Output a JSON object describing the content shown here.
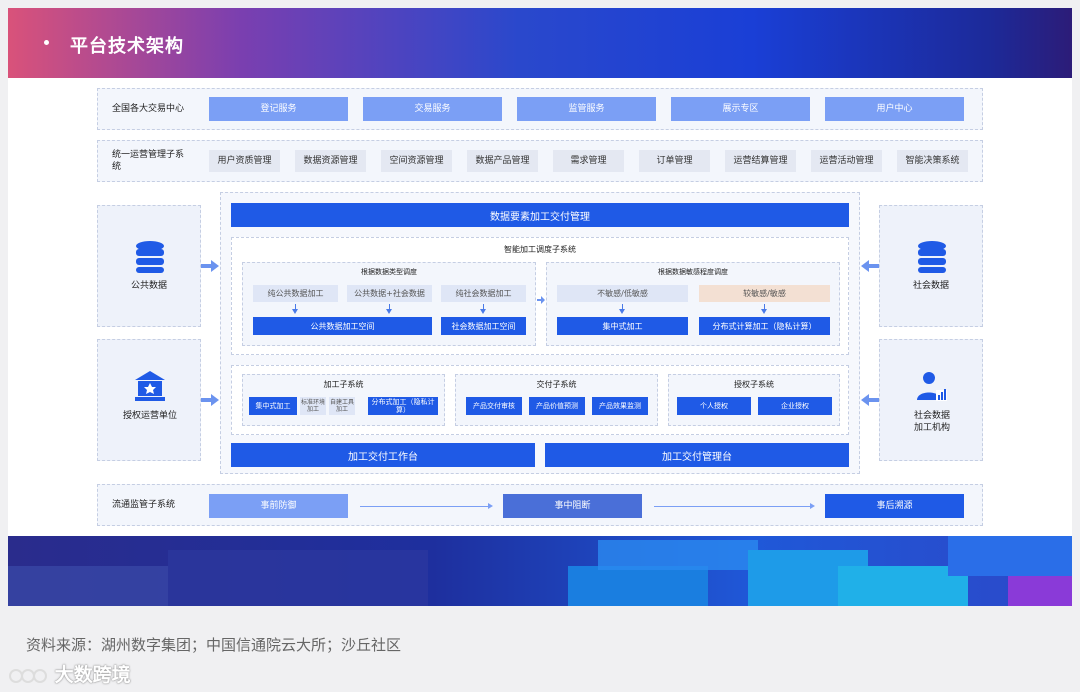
{
  "header": {
    "title": "平台技术架构"
  },
  "row1": {
    "label": "全国各大交易中心",
    "items": [
      "登记服务",
      "交易服务",
      "监管服务",
      "展示专区",
      "用户中心"
    ]
  },
  "row2": {
    "label": "统一运营管理子系统",
    "items": [
      "用户资质管理",
      "数据资源管理",
      "空间资源管理",
      "数据产品管理",
      "需求管理",
      "订单管理",
      "运营结算管理",
      "运营活动管理",
      "智能决策系统"
    ]
  },
  "left": {
    "public_data": "公共数据",
    "auth_unit": "授权运营单位"
  },
  "right": {
    "social_data": "社会数据",
    "social_org": "社会数据加工机构"
  },
  "center": {
    "top_bar": "数据要素加工交付管理",
    "scheduler_title": "智能加工调度子系统",
    "by_type": {
      "title": "根据数据类型调度",
      "sources": [
        "纯公共数据加工",
        "公共数据+社会数据",
        "纯社会数据加工"
      ],
      "targets": [
        "公共数据加工空间",
        "社会数据加工空间"
      ]
    },
    "by_sensitivity": {
      "title": "根据数据敏感程度调度",
      "sources": [
        "不敏感/低敏感",
        "较敏感/敏感"
      ],
      "targets": [
        "集中式加工",
        "分布式计算加工（隐私计算）"
      ]
    },
    "processing": {
      "title": "加工子系统",
      "items": [
        "集中式加工",
        "标准环境加工",
        "自建工具加工",
        "分布式加工（隐私计算）"
      ]
    },
    "delivery": {
      "title": "交付子系统",
      "items": [
        "产品交付审核",
        "产品价值预测",
        "产品效果监测"
      ]
    },
    "authorization": {
      "title": "授权子系统",
      "items": [
        "个人授权",
        "企业授权"
      ]
    },
    "bottom_left": "加工交付工作台",
    "bottom_right": "加工交付管理台"
  },
  "row3": {
    "label": "流通监管子系统",
    "items": [
      "事前防御",
      "事中阻断",
      "事后溯源"
    ]
  },
  "source_text": "资料来源：湖州数字集团；中国信通院云大所；沙丘社区",
  "watermark": "大数跨境",
  "colors": {
    "primary": "#1f5ae6",
    "light": "#7b9ff5",
    "banner_start": "#d9527a",
    "banner_end": "#1c2a9a"
  }
}
